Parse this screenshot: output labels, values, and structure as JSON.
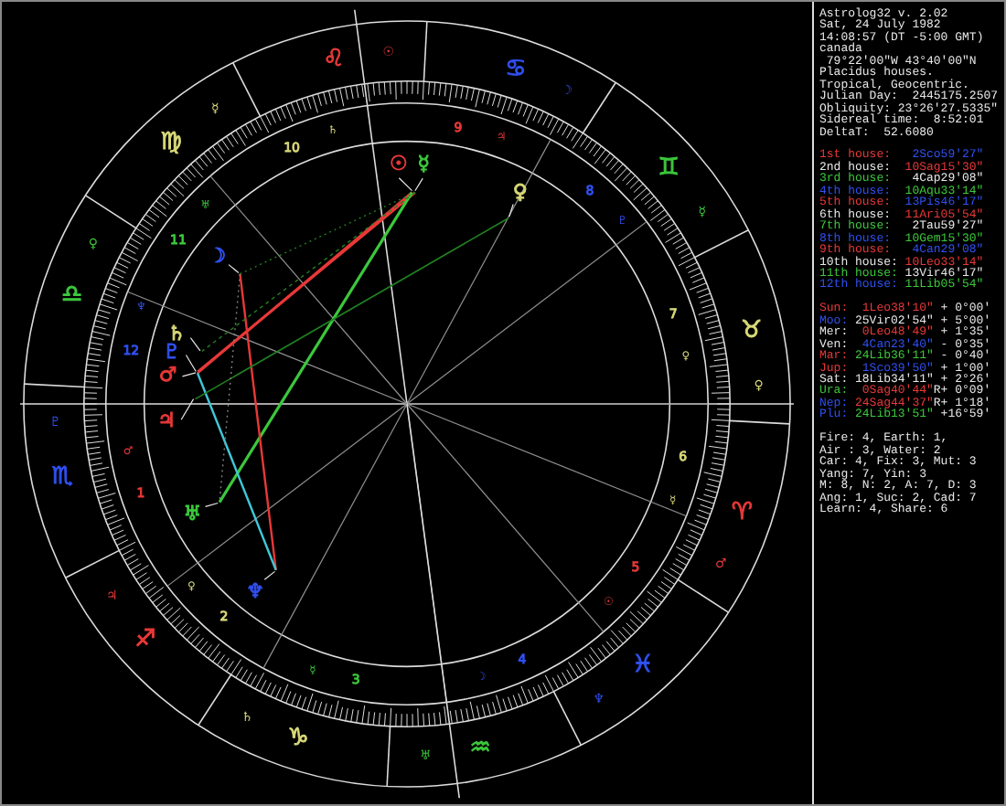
{
  "wheel": {
    "signs": [
      {
        "glyph": "♈",
        "ruler": "♂",
        "color": "#e83838"
      },
      {
        "glyph": "♉",
        "ruler": "♀",
        "color": "#d8d878"
      },
      {
        "glyph": "♊",
        "ruler": "☿",
        "color": "#3cc83c"
      },
      {
        "glyph": "♋",
        "ruler": "☽",
        "color": "#3050f0"
      },
      {
        "glyph": "♌",
        "ruler": "☉",
        "color": "#e83838"
      },
      {
        "glyph": "♍",
        "ruler": "☿",
        "color": "#d8d878"
      },
      {
        "glyph": "♎",
        "ruler": "♀",
        "color": "#3cc83c"
      },
      {
        "glyph": "♏",
        "ruler": "♇",
        "color": "#3050f0"
      },
      {
        "glyph": "♐",
        "ruler": "♃",
        "color": "#e83838"
      },
      {
        "glyph": "♑",
        "ruler": "♄",
        "color": "#d8d878"
      },
      {
        "glyph": "♒",
        "ruler": "♅",
        "color": "#3cc83c"
      },
      {
        "glyph": "♓",
        "ruler": "♆",
        "color": "#3050f0"
      }
    ],
    "houses": [
      {
        "number": "10",
        "glyph": "♄",
        "color": "#d8d878"
      },
      {
        "number": "9",
        "glyph": "♃",
        "color": "#e83838"
      },
      {
        "number": "11",
        "glyph": "♅",
        "color": "#3cc83c"
      },
      {
        "number": "8",
        "glyph": "♇",
        "color": "#3050f0"
      },
      {
        "number": "12",
        "glyph": "♆",
        "color": "#3050f0"
      },
      {
        "number": "7",
        "glyph": "♀",
        "color": "#d8d878"
      },
      {
        "number": "1",
        "glyph": "♂",
        "color": "#e83838"
      },
      {
        "number": "6",
        "glyph": "☿",
        "color": "#d8d878"
      },
      {
        "number": "2",
        "glyph": "♀",
        "color": "#d8d878"
      },
      {
        "number": "5",
        "glyph": "☉",
        "color": "#e83838"
      },
      {
        "number": "3",
        "glyph": "☿",
        "color": "#3cc83c"
      },
      {
        "number": "4",
        "glyph": "☽",
        "color": "#3050f0"
      }
    ],
    "planets": [
      {
        "glyph": "☉",
        "color": "#e83838"
      },
      {
        "glyph": "☽",
        "color": "#3050f0"
      },
      {
        "glyph": "☿",
        "color": "#3cc83c"
      },
      {
        "glyph": "♀",
        "color": "#d8d878"
      },
      {
        "glyph": "♂",
        "color": "#e83838"
      },
      {
        "glyph": "♃",
        "color": "#e83838"
      },
      {
        "glyph": "♄",
        "color": "#d8d878"
      },
      {
        "glyph": "♅",
        "color": "#3cc83c"
      },
      {
        "glyph": "♆",
        "color": "#3050f0"
      },
      {
        "glyph": "♇",
        "color": "#3050f0"
      }
    ]
  },
  "info": {
    "header": [
      "Astrolog32 v. 2.02",
      "Sat, 24 July 1982",
      "14:08:57 (DT -5:00 GMT)",
      "canada",
      " 79°22'00\"W 43°40'00\"N",
      "Placidus houses.",
      "Tropical, Geocentric.",
      "Julian Day:  2445175.2507",
      "Obliquity: 23°26'27.5335\"",
      "Sidereal time:  8:52:01",
      "DeltaT:  52.6080"
    ],
    "houses": [
      {
        "label": {
          "text": "1st house:",
          "color": "#e83838"
        },
        "position": {
          "text": "2Sco59'27\"",
          "color": "#3050f0"
        }
      },
      {
        "label": {
          "text": "2nd house:",
          "color": "#e8e8e8"
        },
        "position": {
          "text": "10Sag15'30\"",
          "color": "#e83838"
        }
      },
      {
        "label": {
          "text": "3rd house:",
          "color": "#3cc83c"
        },
        "position": {
          "text": "4Cap29'08\"",
          "color": "#e8e8e8"
        }
      },
      {
        "label": {
          "text": "4th house:",
          "color": "#3050f0"
        },
        "position": {
          "text": "10Aqu33'14\"",
          "color": "#3cc83c"
        }
      },
      {
        "label": {
          "text": "5th house:",
          "color": "#e83838"
        },
        "position": {
          "text": "13Pis46'17\"",
          "color": "#3050f0"
        }
      },
      {
        "label": {
          "text": "6th house:",
          "color": "#e8e8e8"
        },
        "position": {
          "text": "11Ari05'54\"",
          "color": "#e83838"
        }
      },
      {
        "label": {
          "text": "7th house:",
          "color": "#3cc83c"
        },
        "position": {
          "text": "2Tau59'27\"",
          "color": "#e8e8e8"
        }
      },
      {
        "label": {
          "text": "8th house:",
          "color": "#3050f0"
        },
        "position": {
          "text": "10Gem15'30\"",
          "color": "#3cc83c"
        }
      },
      {
        "label": {
          "text": "9th house:",
          "color": "#e83838"
        },
        "position": {
          "text": "4Can29'08\"",
          "color": "#3050f0"
        }
      },
      {
        "label": {
          "text": "10th house:",
          "color": "#e8e8e8"
        },
        "position": {
          "text": "10Leo33'14\"",
          "color": "#e83838"
        }
      },
      {
        "label": {
          "text": "11th house:",
          "color": "#3cc83c"
        },
        "position": {
          "text": "13Vir46'17\"",
          "color": "#e8e8e8"
        }
      },
      {
        "label": {
          "text": "12th house:",
          "color": "#3050f0"
        },
        "position": {
          "text": "11Lib05'54\"",
          "color": "#3cc83c"
        }
      }
    ],
    "planets": [
      {
        "label": {
          "text": "Sun:",
          "color": "#e83838"
        },
        "position": {
          "text": "1Leo38'10\"",
          "color": "#e83838"
        },
        "latitude": "+ 0°00'"
      },
      {
        "label": {
          "text": "Moo:",
          "color": "#3050f0"
        },
        "position": {
          "text": "25Vir02'54\"",
          "color": "#e8e8e8"
        },
        "latitude": "+ 5°00'"
      },
      {
        "label": {
          "text": "Mer:",
          "color": "#e8e8e8"
        },
        "position": {
          "text": "0Leo48'49\"",
          "color": "#e83838"
        },
        "latitude": "+ 1°35'"
      },
      {
        "label": {
          "text": "Ven:",
          "color": "#e8e8e8"
        },
        "position": {
          "text": "4Can23'40\"",
          "color": "#3050f0"
        },
        "latitude": "- 0°35'"
      },
      {
        "label": {
          "text": "Mar:",
          "color": "#e83838"
        },
        "position": {
          "text": "24Lib36'11\"",
          "color": "#3cc83c"
        },
        "latitude": "- 0°40'"
      },
      {
        "label": {
          "text": "Jup:",
          "color": "#e83838"
        },
        "position": {
          "text": "1Sco39'50\"",
          "color": "#3050f0"
        },
        "latitude": "+ 1°00'"
      },
      {
        "label": {
          "text": "Sat:",
          "color": "#e8e8e8"
        },
        "position": {
          "text": "18Lib34'11\"",
          "color": "#e8e8e8"
        },
        "latitude": "+ 2°26'"
      },
      {
        "label": {
          "text": "Ura:",
          "color": "#3cc83c"
        },
        "position": {
          "text": "0Sag40'44\"",
          "color": "#e83838"
        },
        "retrograde_mark": "R",
        "latitude": "+ 0°09'"
      },
      {
        "label": {
          "text": "Nep:",
          "color": "#3050f0"
        },
        "position": {
          "text": "24Sag44'37\"",
          "color": "#e83838"
        },
        "retrograde_mark": "R",
        "latitude": "+ 1°18'"
      },
      {
        "label": {
          "text": "Plu:",
          "color": "#3050f0"
        },
        "position": {
          "text": "24Lib13'51\"",
          "color": "#3cc83c"
        },
        "latitude": "+16°59'"
      }
    ],
    "summary": [
      "Fire: 4, Earth: 1,",
      "Air : 3, Water: 2",
      "Car: 4, Fix: 3, Mut: 3",
      "Yang: 7, Yin: 3",
      "M: 8, N: 2, A: 7, D: 3",
      "Ang: 1, Suc: 2, Cad: 7",
      "Learn: 4, Share: 6"
    ]
  }
}
